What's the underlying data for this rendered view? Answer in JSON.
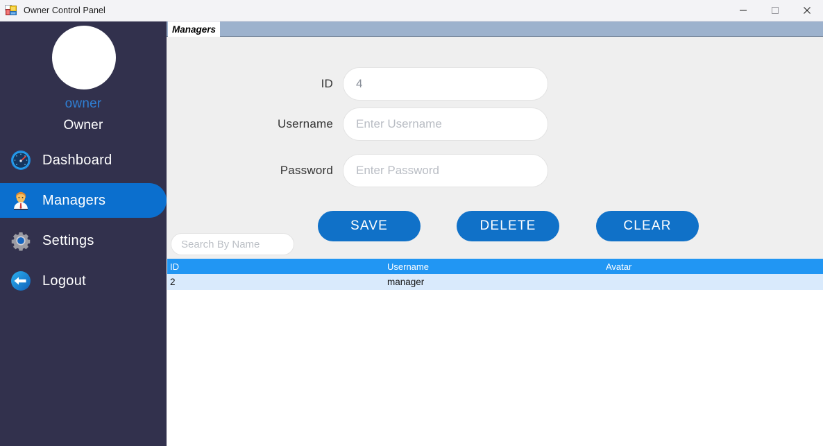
{
  "window": {
    "title": "Owner Control Panel",
    "app_icon": "winforms-app-icon",
    "controls": {
      "minimize": "minimize-icon",
      "maximize": "maximize-icon",
      "close": "close-icon"
    }
  },
  "colors": {
    "sidebar_bg": "#32314d",
    "sidebar_selected": "#0b6fce",
    "accent_button": "#1071c8",
    "grid_header": "#2196f3",
    "grid_row": "#d9eafc",
    "form_bg": "#efefef",
    "tabstrip": "#9db2cd",
    "username_link": "#2f7fd4"
  },
  "sidebar": {
    "avatar": "user-avatar",
    "username": "owner",
    "role": "Owner",
    "items": [
      {
        "label": "Dashboard",
        "icon": "dashboard-gauge-icon",
        "selected": false
      },
      {
        "label": "Managers",
        "icon": "manager-person-icon",
        "selected": true
      },
      {
        "label": "Settings",
        "icon": "gear-icon",
        "selected": false
      },
      {
        "label": "Logout",
        "icon": "logout-arrow-icon",
        "selected": false
      }
    ]
  },
  "main": {
    "tab": {
      "label": "Managers"
    },
    "form": {
      "fields": [
        {
          "label": "ID",
          "value": "4",
          "placeholder": "",
          "filled": true
        },
        {
          "label": "Username",
          "value": "",
          "placeholder": "Enter Username",
          "filled": false
        },
        {
          "label": "Password",
          "value": "",
          "placeholder": "Enter Password",
          "filled": false
        }
      ],
      "buttons": [
        {
          "label": "SAVE"
        },
        {
          "label": "DELETE"
        },
        {
          "label": "CLEAR"
        }
      ]
    },
    "search": {
      "placeholder": "Search By Name",
      "value": ""
    },
    "grid": {
      "columns": [
        "ID",
        "Username",
        "Avatar"
      ],
      "rows": [
        {
          "id": "2",
          "username": "manager",
          "avatar": ""
        }
      ]
    }
  }
}
